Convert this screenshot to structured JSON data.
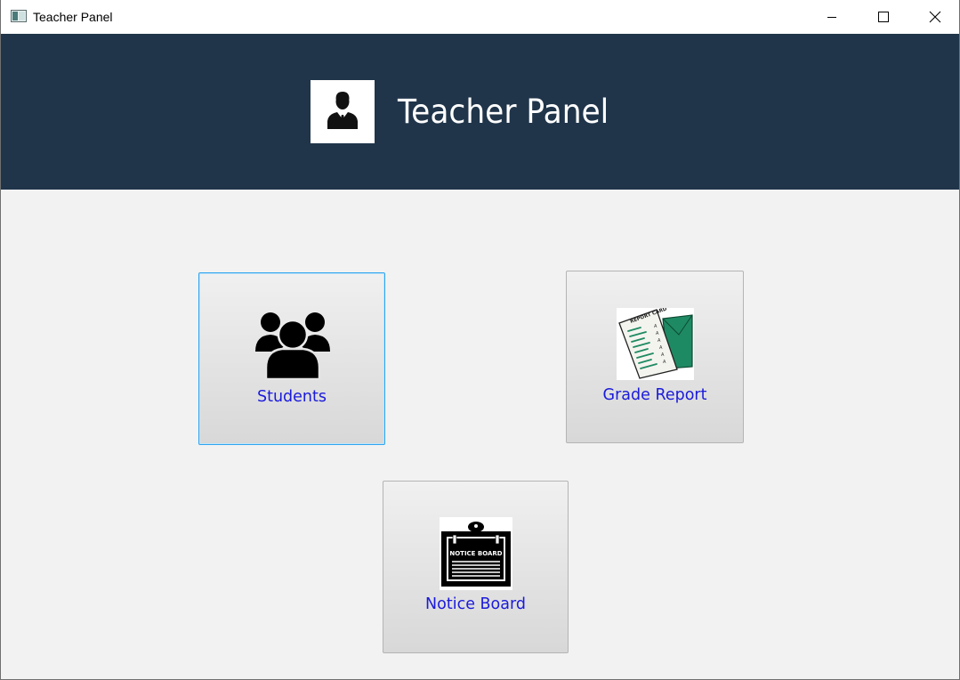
{
  "window": {
    "title": "Teacher Panel",
    "controls": [
      "minimize-icon",
      "maximize-icon",
      "close-icon"
    ]
  },
  "header": {
    "title": "Teacher Panel",
    "avatar_icon": "teacher-avatar-icon",
    "background_color": "#20354a"
  },
  "tiles": [
    {
      "label": "Students",
      "icon": "students-group-icon",
      "focused": true
    },
    {
      "label": "Grade Report",
      "icon": "report-card-icon",
      "focused": false
    },
    {
      "label": "Notice Board",
      "icon": "notice-board-icon",
      "focused": false
    }
  ],
  "notice_board_icon_text": "NOTICE BOARD",
  "report_card_icon_text": "REPORT CARD",
  "colors": {
    "tile_label": "#1a1adb",
    "focus_border": "#2ea5ef",
    "content_background": "#f2f2f2"
  }
}
